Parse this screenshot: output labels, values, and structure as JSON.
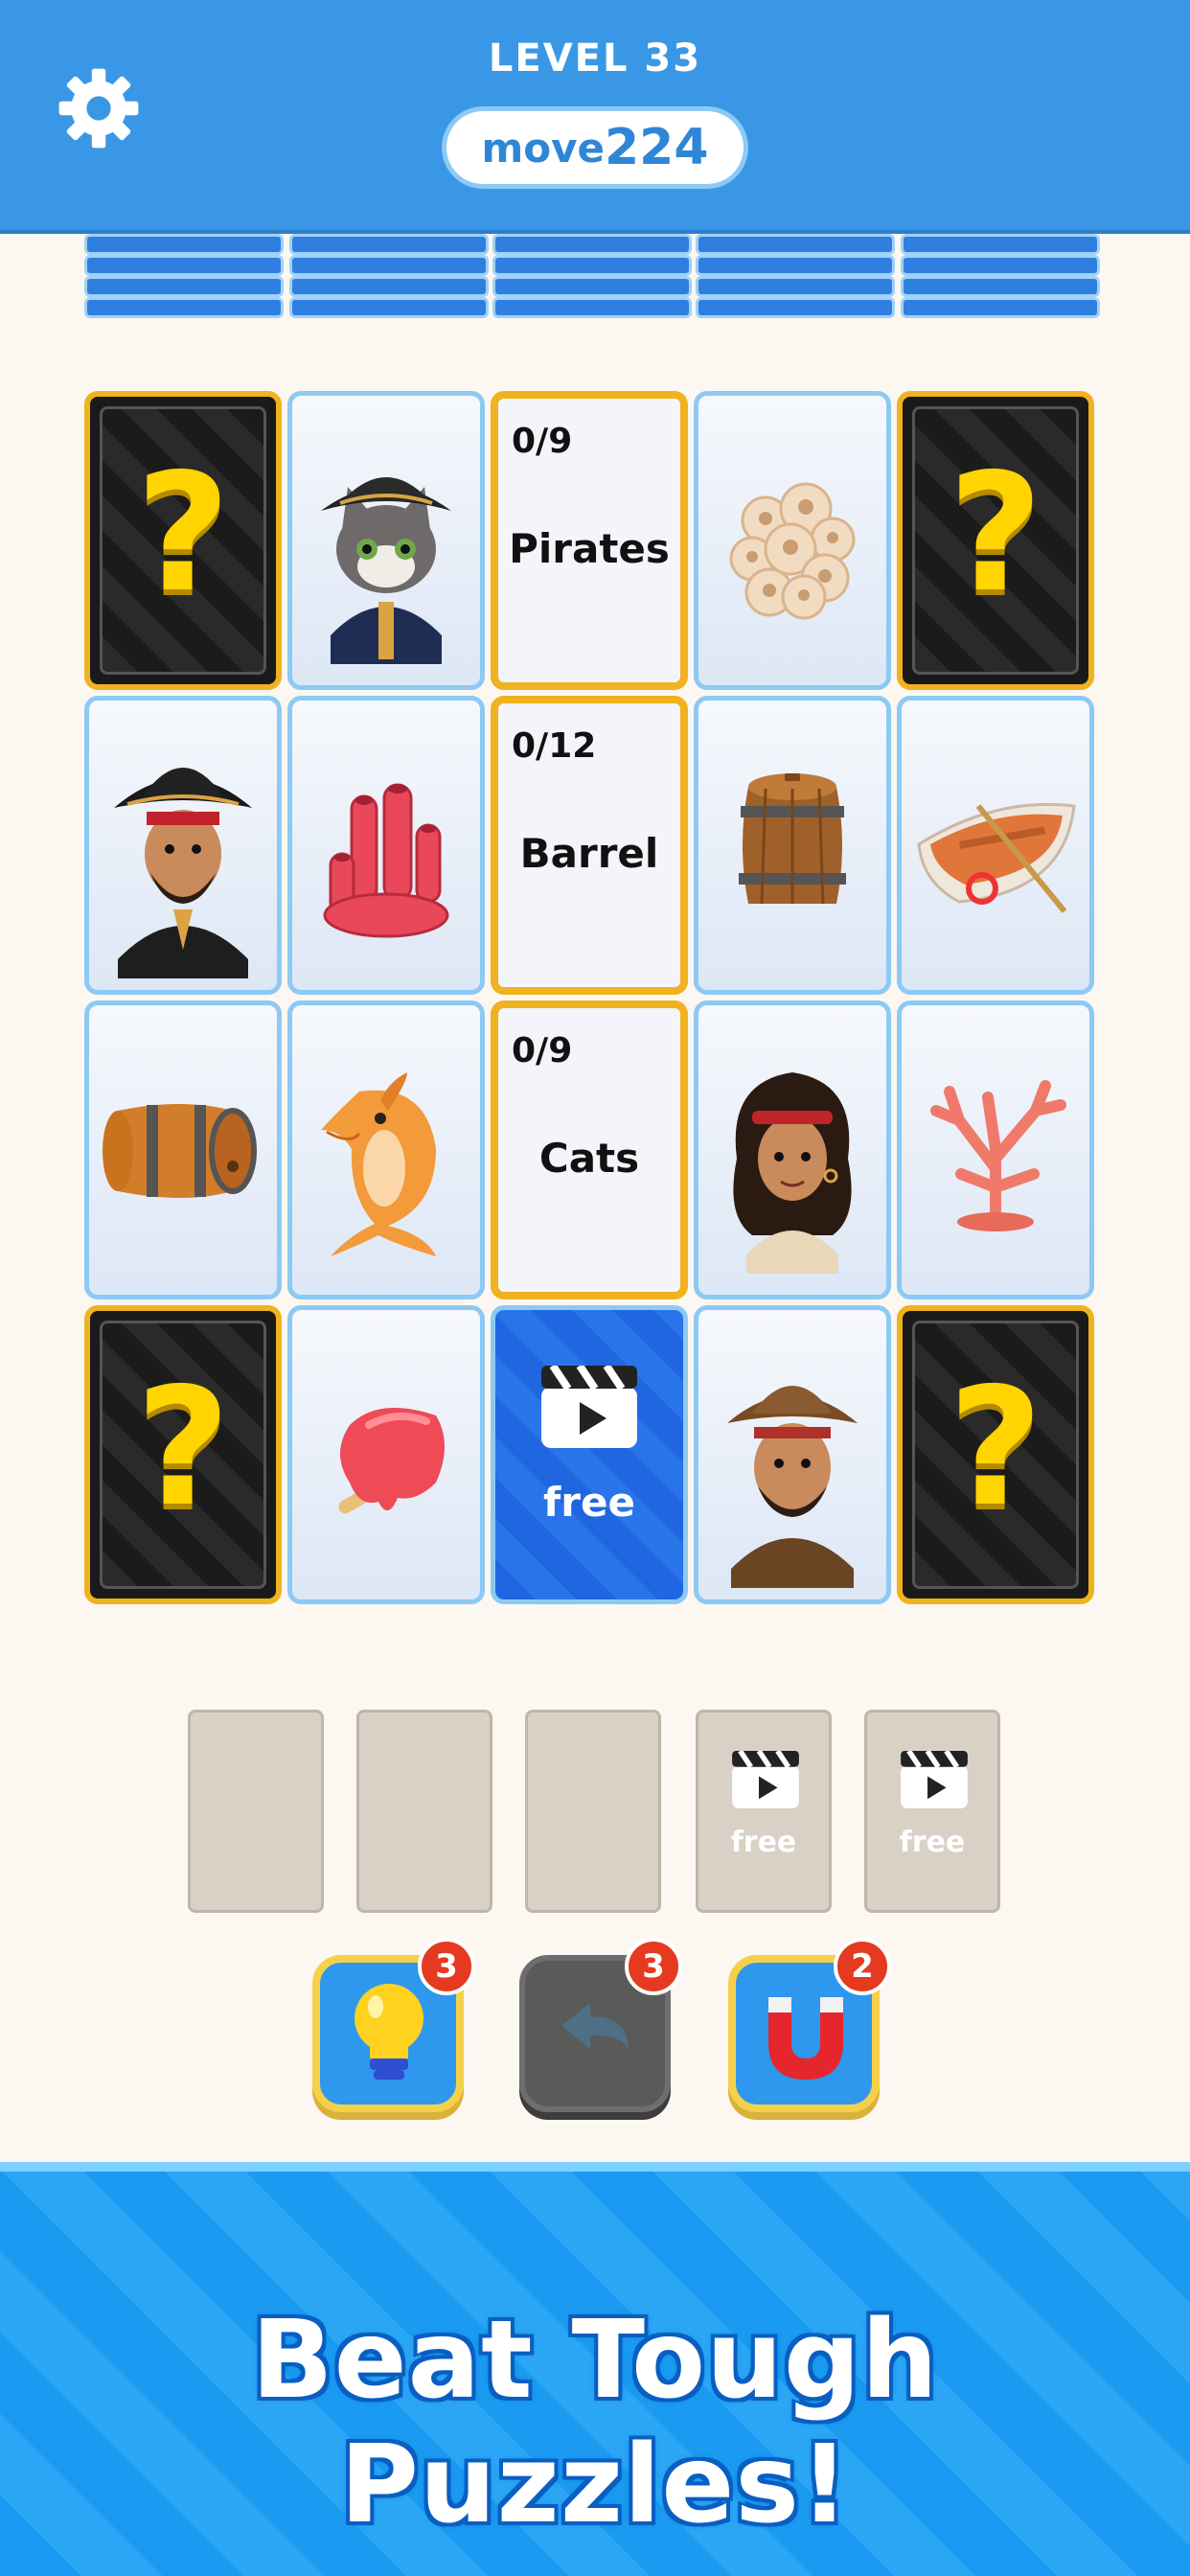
{
  "header": {
    "level_label": "LEVEL 33",
    "moves_label": "move",
    "moves_value": "224",
    "settings_icon": "gear-icon",
    "background_color": "#3a97e6"
  },
  "board": {
    "rows": [
      [
        {
          "type": "mystery",
          "label": "?"
        },
        {
          "type": "picture",
          "icon": "pirate-cat-icon"
        },
        {
          "type": "category",
          "count": "0/9",
          "name": "Pirates"
        },
        {
          "type": "picture",
          "icon": "sponge-coral-icon"
        },
        {
          "type": "mystery",
          "label": "?"
        }
      ],
      [
        {
          "type": "picture",
          "icon": "pirate-captain-icon"
        },
        {
          "type": "picture",
          "icon": "red-tube-coral-icon"
        },
        {
          "type": "category",
          "count": "0/12",
          "name": "Barrel"
        },
        {
          "type": "picture",
          "icon": "wooden-barrel-icon"
        },
        {
          "type": "picture",
          "icon": "rowboat-icon"
        }
      ],
      [
        {
          "type": "picture",
          "icon": "barrel-on-side-icon"
        },
        {
          "type": "picture",
          "icon": "dolphin-icon"
        },
        {
          "type": "category",
          "count": "0/9",
          "name": "Cats"
        },
        {
          "type": "picture",
          "icon": "pirate-girl-icon"
        },
        {
          "type": "picture",
          "icon": "pink-coral-icon"
        }
      ],
      [
        {
          "type": "mystery",
          "label": "?"
        },
        {
          "type": "picture",
          "icon": "melting-popsicle-icon"
        },
        {
          "type": "free",
          "label": "free",
          "icon": "video-clapper-icon"
        },
        {
          "type": "picture",
          "icon": "pirate-man-icon"
        },
        {
          "type": "mystery",
          "label": "?"
        }
      ]
    ]
  },
  "slots": [
    {
      "state": "empty"
    },
    {
      "state": "empty"
    },
    {
      "state": "empty"
    },
    {
      "state": "free",
      "label": "free",
      "icon": "video-clapper-icon"
    },
    {
      "state": "free",
      "label": "free",
      "icon": "video-clapper-icon"
    }
  ],
  "powerups": [
    {
      "name": "hint",
      "icon": "lightbulb-icon",
      "count": "3",
      "active": true
    },
    {
      "name": "undo",
      "icon": "undo-arrow-icon",
      "count": "3",
      "active": false
    },
    {
      "name": "magnet",
      "icon": "magnet-icon",
      "count": "2",
      "active": true
    }
  ],
  "banner": {
    "text": "Beat Tough Puzzles!"
  },
  "colors": {
    "accent_gold": "#f0b21f",
    "tile_border": "#8ccaf5",
    "badge_red": "#e53a1f"
  }
}
